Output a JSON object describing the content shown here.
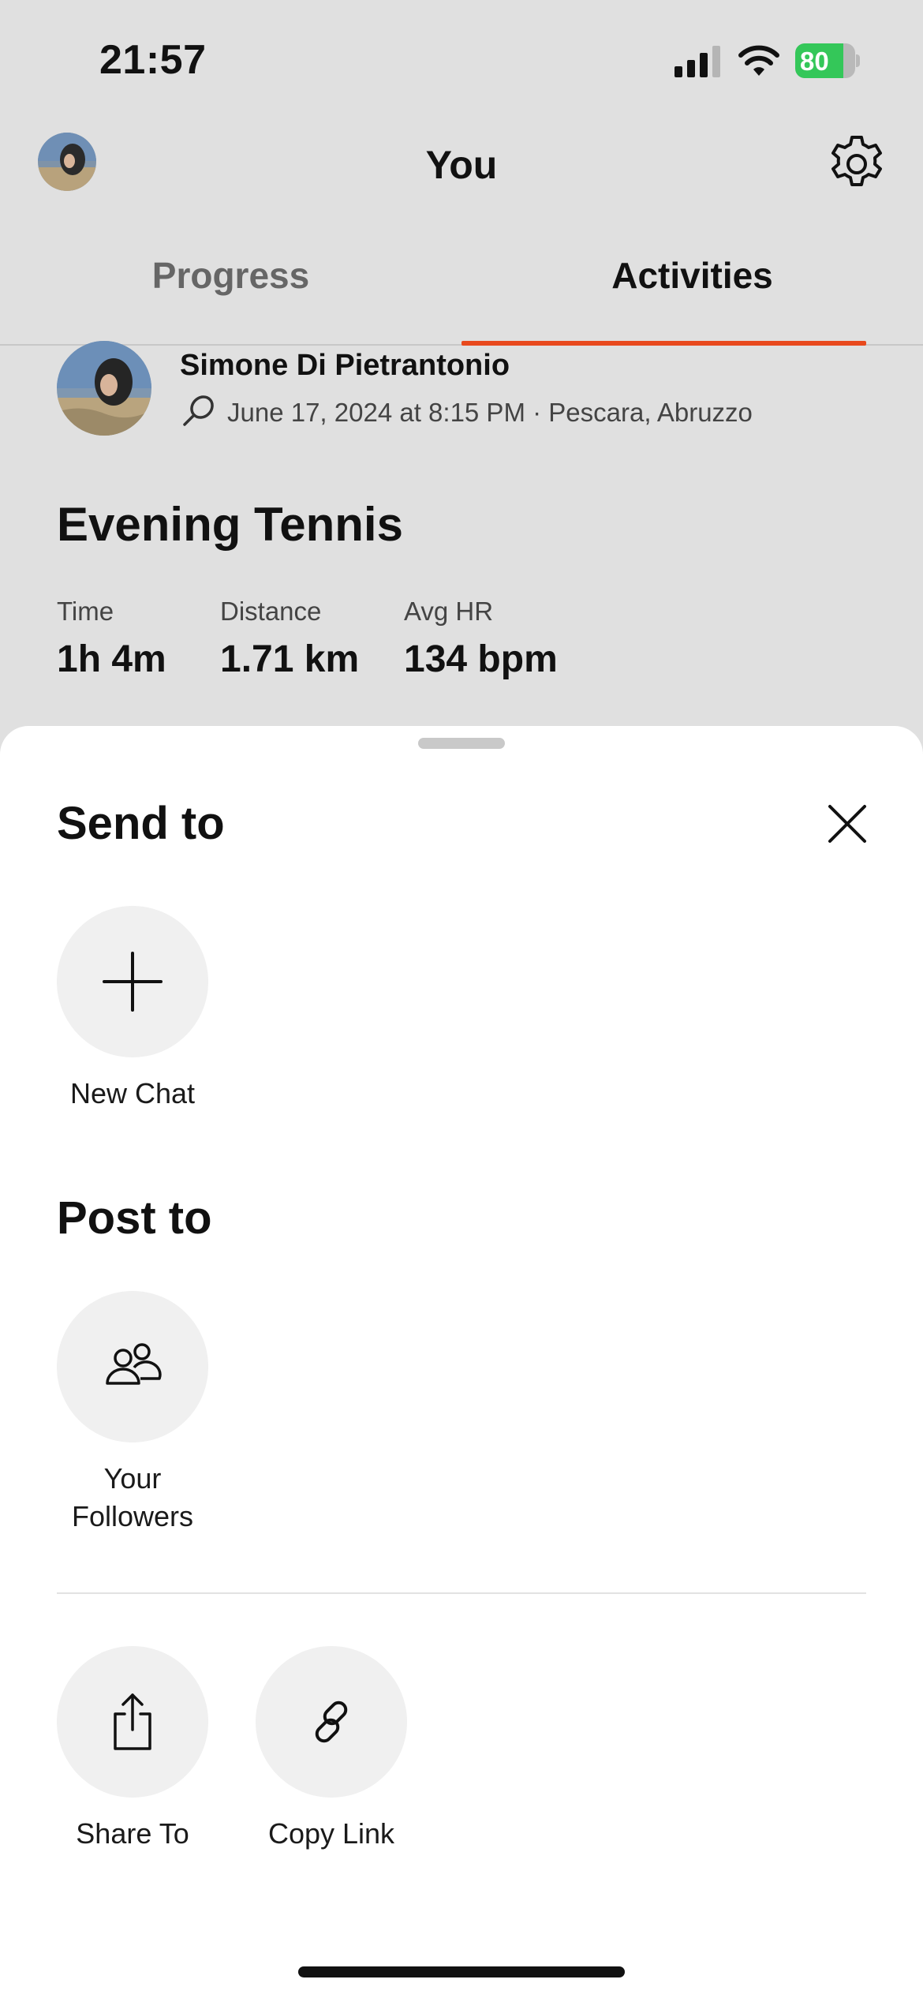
{
  "status_bar": {
    "time": "21:57",
    "battery_percent": "80",
    "battery_level": 0.8,
    "signal_bars": 3,
    "icons": [
      "signal-icon",
      "wifi-icon",
      "battery-icon"
    ]
  },
  "header": {
    "title": "You",
    "settings_icon": "gear-icon"
  },
  "tabs": [
    {
      "label": "Progress",
      "selected": false
    },
    {
      "label": "Activities",
      "selected": true
    }
  ],
  "activity": {
    "athlete_name": "Simone Di Pietrantonio",
    "sport_icon": "tennis-racket-icon",
    "meta": "June 17, 2024 at 8:15 PM · Pescara, Abruzzo",
    "title": "Evening Tennis",
    "stats": [
      {
        "label": "Time",
        "value": "1h 4m"
      },
      {
        "label": "Distance",
        "value": "1.71 km"
      },
      {
        "label": "Avg HR",
        "value": "134 bpm"
      }
    ]
  },
  "sheet": {
    "send_title": "Send to",
    "send_options": [
      {
        "label": "New Chat",
        "icon": "plus-icon"
      }
    ],
    "post_title": "Post to",
    "post_options": [
      {
        "label_line1": "Your",
        "label_line2": "Followers",
        "icon": "people-icon"
      }
    ],
    "share_options": [
      {
        "label": "Share To",
        "icon": "share-icon"
      },
      {
        "label": "Copy Link",
        "icon": "link-icon"
      }
    ]
  },
  "colors": {
    "accent": "#e8491d",
    "battery_green": "#34c759",
    "background_dimmed": "#e0e0e0",
    "sheet": "#ffffff"
  }
}
